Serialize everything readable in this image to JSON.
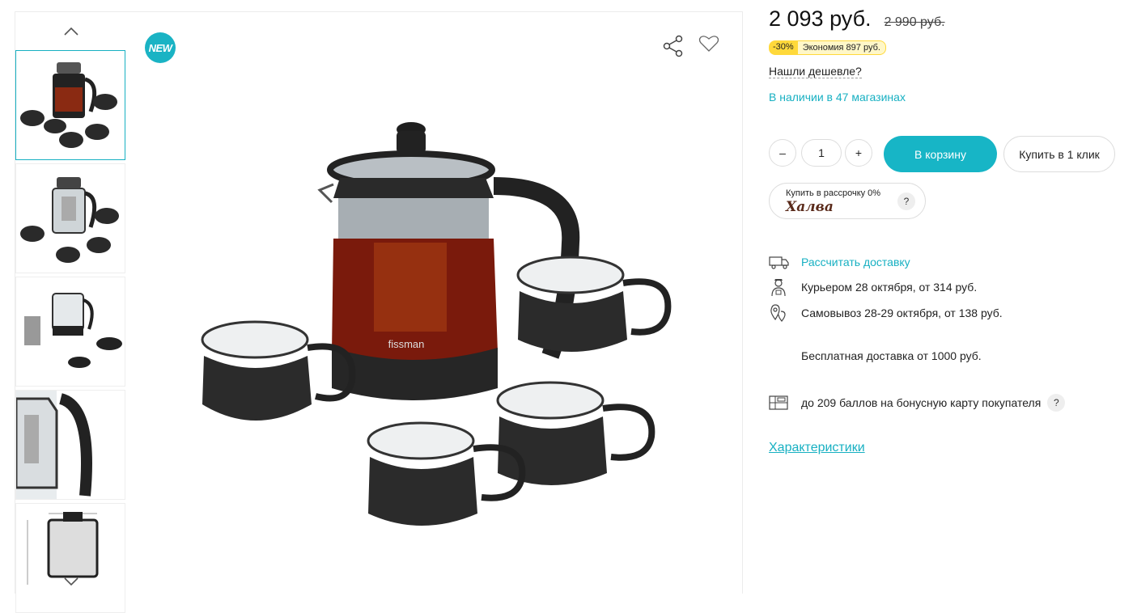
{
  "gallery": {
    "new_badge": "NEW",
    "thumbnails": [
      "thumbnail-1",
      "thumbnail-2",
      "thumbnail-3",
      "thumbnail-4",
      "thumbnail-5"
    ],
    "main_brand_label": "fissman"
  },
  "price": {
    "current": "2 093 руб.",
    "old": "2 990 руб.",
    "discount": "-30%",
    "savings": "Экономия 897 руб."
  },
  "links": {
    "cheaper": "Нашли дешевле?",
    "stock": "В наличии в 47 магазинах",
    "characteristics": "Характеристики"
  },
  "cart": {
    "minus": "–",
    "quantity": "1",
    "plus": "+",
    "add_label": "В корзину",
    "one_click_label": "Купить в 1 клик"
  },
  "installment": {
    "text": "Купить в рассрочку 0%",
    "logo": "Халва",
    "help": "?"
  },
  "delivery": {
    "calc": "Рассчитать доставку",
    "courier": "Курьером 28 октября, от 314 руб.",
    "pickup": "Самовывоз 28-29 октября, от 138 руб.",
    "free": "Бесплатная доставка от 1000 руб.",
    "bonus": "до 209 баллов на бонусную карту покупателя",
    "bonus_help": "?"
  },
  "colors": {
    "accent": "#17b5c6",
    "discount_badge": "#ffd93b"
  },
  "icons": [
    "chevron-up-icon",
    "chevron-down-icon",
    "share-icon",
    "heart-icon",
    "truck-icon",
    "courier-icon",
    "location-icon",
    "bonus-card-icon"
  ]
}
